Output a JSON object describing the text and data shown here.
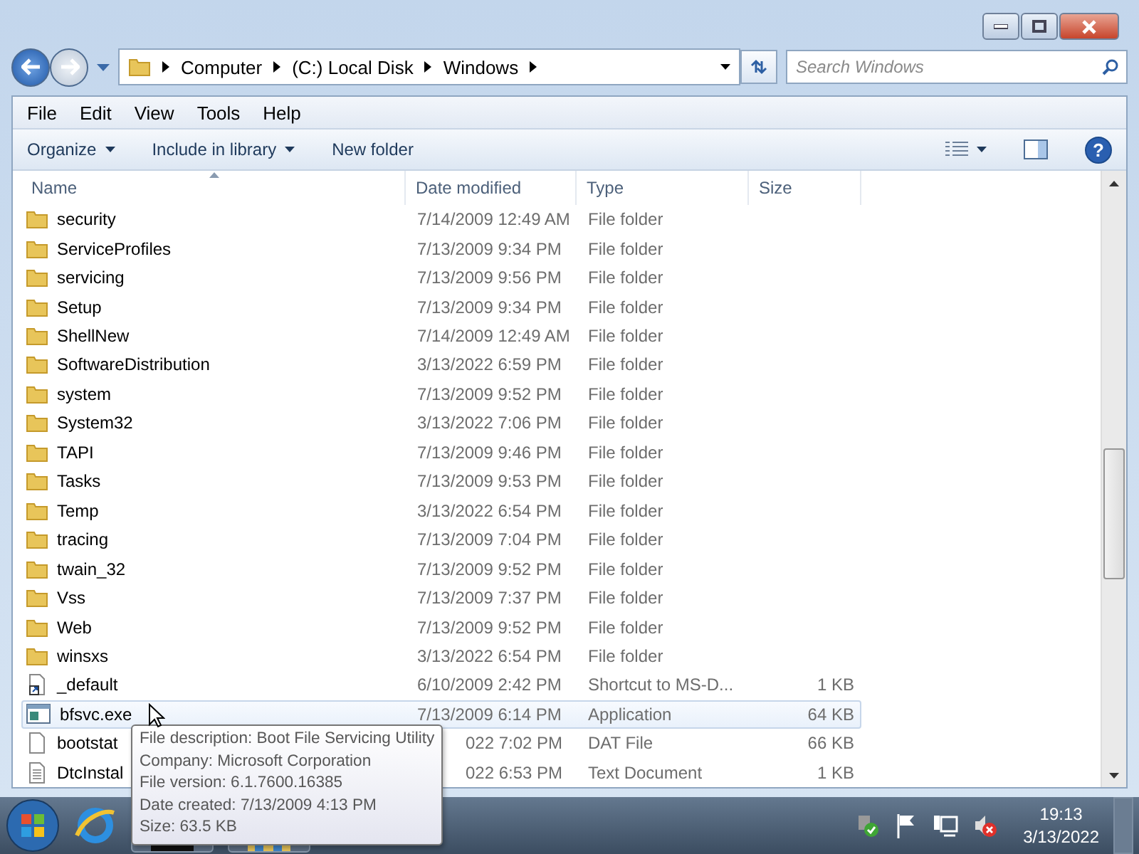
{
  "address": {
    "crumbs": [
      "Computer",
      "(C:) Local Disk",
      "Windows"
    ]
  },
  "search": {
    "placeholder": "Search Windows"
  },
  "menu": [
    "File",
    "Edit",
    "View",
    "Tools",
    "Help"
  ],
  "commands": [
    "Organize",
    "Include in library",
    "New folder"
  ],
  "columns": [
    "Name",
    "Date modified",
    "Type",
    "Size"
  ],
  "rows": [
    {
      "kind": "folder",
      "name": "security",
      "date": "7/14/2009 12:49 AM",
      "type": "File folder",
      "size": "",
      "selected": false
    },
    {
      "kind": "folder",
      "name": "ServiceProfiles",
      "date": "7/13/2009 9:34 PM",
      "type": "File folder",
      "size": "",
      "selected": false
    },
    {
      "kind": "folder",
      "name": "servicing",
      "date": "7/13/2009 9:56 PM",
      "type": "File folder",
      "size": "",
      "selected": false
    },
    {
      "kind": "folder",
      "name": "Setup",
      "date": "7/13/2009 9:34 PM",
      "type": "File folder",
      "size": "",
      "selected": false
    },
    {
      "kind": "folder",
      "name": "ShellNew",
      "date": "7/14/2009 12:49 AM",
      "type": "File folder",
      "size": "",
      "selected": false
    },
    {
      "kind": "folder",
      "name": "SoftwareDistribution",
      "date": "3/13/2022 6:59 PM",
      "type": "File folder",
      "size": "",
      "selected": false
    },
    {
      "kind": "folder",
      "name": "system",
      "date": "7/13/2009 9:52 PM",
      "type": "File folder",
      "size": "",
      "selected": false
    },
    {
      "kind": "folder",
      "name": "System32",
      "date": "3/13/2022 7:06 PM",
      "type": "File folder",
      "size": "",
      "selected": false
    },
    {
      "kind": "folder",
      "name": "TAPI",
      "date": "7/13/2009 9:46 PM",
      "type": "File folder",
      "size": "",
      "selected": false
    },
    {
      "kind": "folder",
      "name": "Tasks",
      "date": "7/13/2009 9:53 PM",
      "type": "File folder",
      "size": "",
      "selected": false
    },
    {
      "kind": "folder",
      "name": "Temp",
      "date": "3/13/2022 6:54 PM",
      "type": "File folder",
      "size": "",
      "selected": false
    },
    {
      "kind": "folder",
      "name": "tracing",
      "date": "7/13/2009 7:04 PM",
      "type": "File folder",
      "size": "",
      "selected": false
    },
    {
      "kind": "folder",
      "name": "twain_32",
      "date": "7/13/2009 9:52 PM",
      "type": "File folder",
      "size": "",
      "selected": false
    },
    {
      "kind": "folder",
      "name": "Vss",
      "date": "7/13/2009 7:37 PM",
      "type": "File folder",
      "size": "",
      "selected": false
    },
    {
      "kind": "folder",
      "name": "Web",
      "date": "7/13/2009 9:52 PM",
      "type": "File folder",
      "size": "",
      "selected": false
    },
    {
      "kind": "folder",
      "name": "winsxs",
      "date": "3/13/2022 6:54 PM",
      "type": "File folder",
      "size": "",
      "selected": false
    },
    {
      "kind": "shortcut",
      "name": "_default",
      "date": "6/10/2009 2:42 PM",
      "type": "Shortcut to MS-D...",
      "size": "1 KB",
      "selected": false
    },
    {
      "kind": "application",
      "name": "bfsvc.exe",
      "date": "7/13/2009 6:14 PM",
      "type": "Application",
      "size": "64 KB",
      "selected": true
    },
    {
      "kind": "file",
      "name": "bootstat",
      "date": "022 7:02 PM",
      "type": "DAT File",
      "size": "66 KB",
      "selected": false,
      "covered": true
    },
    {
      "kind": "text",
      "name": "DtcInstal",
      "date": "022 6:53 PM",
      "type": "Text Document",
      "size": "1 KB",
      "selected": false,
      "covered": true
    }
  ],
  "tooltip": [
    "File description: Boot File Servicing Utility",
    "Company: Microsoft Corporation",
    "File version: 6.1.7600.16385",
    "Date created: 7/13/2009 4:13 PM",
    "Size: 63.5 KB"
  ],
  "help": "?",
  "clock": {
    "time": "19:13",
    "date": "3/13/2022"
  }
}
